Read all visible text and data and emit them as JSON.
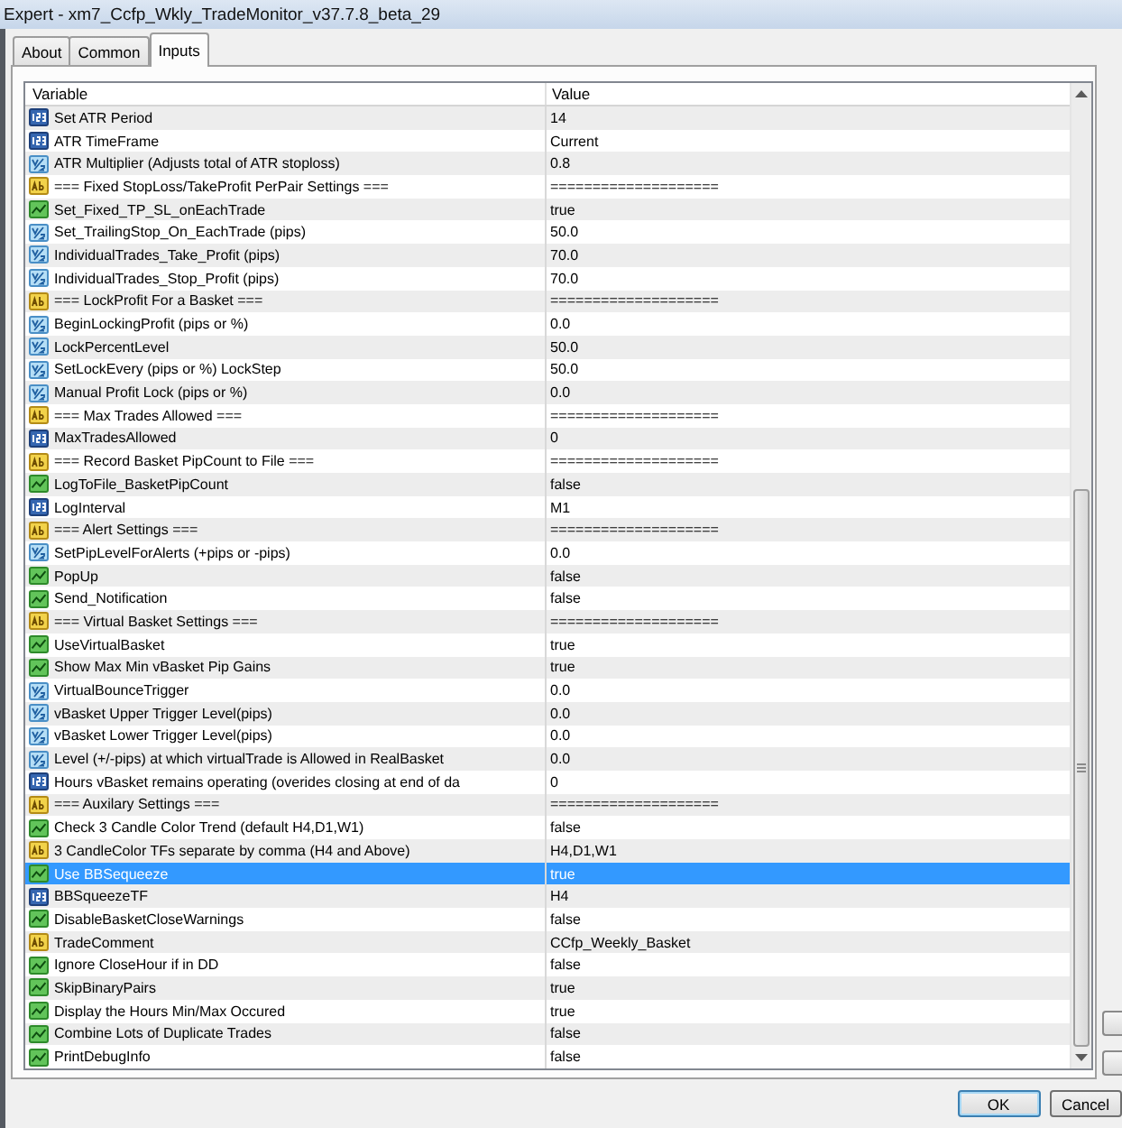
{
  "window": {
    "title": "Expert - xm7_Ccfp_Wkly_TradeMonitor_v37.7.8_beta_29"
  },
  "tabs": [
    {
      "label": "About",
      "selected": false
    },
    {
      "label": "Common",
      "selected": false
    },
    {
      "label": "Inputs",
      "selected": true
    }
  ],
  "inputs": {
    "columns": [
      "Variable",
      "Value"
    ],
    "rows": [
      {
        "kind": "int",
        "variable": "Set ATR Period",
        "value": "14",
        "selected": false
      },
      {
        "kind": "int",
        "variable": "ATR TimeFrame",
        "value": "Current",
        "selected": false
      },
      {
        "kind": "double",
        "variable": "ATR Multiplier (Adjusts total of ATR stoploss)",
        "value": "0.8",
        "selected": false
      },
      {
        "kind": "string",
        "variable": "=== Fixed StopLoss/TakeProfit PerPair Settings ===",
        "value": "====================",
        "selected": false
      },
      {
        "kind": "bool",
        "variable": "Set_Fixed_TP_SL_onEachTrade",
        "value": "true",
        "selected": false
      },
      {
        "kind": "double",
        "variable": "Set_TrailingStop_On_EachTrade (pips)",
        "value": "50.0",
        "selected": false
      },
      {
        "kind": "double",
        "variable": "IndividualTrades_Take_Profit (pips)",
        "value": "70.0",
        "selected": false
      },
      {
        "kind": "double",
        "variable": "IndividualTrades_Stop_Profit (pips)",
        "value": "70.0",
        "selected": false
      },
      {
        "kind": "string",
        "variable": "=== LockProfit For a Basket ===",
        "value": "====================",
        "selected": false
      },
      {
        "kind": "double",
        "variable": "BeginLockingProfit (pips or %)",
        "value": "0.0",
        "selected": false
      },
      {
        "kind": "double",
        "variable": "LockPercentLevel",
        "value": "50.0",
        "selected": false
      },
      {
        "kind": "double",
        "variable": "SetLockEvery (pips or %)  LockStep",
        "value": "50.0",
        "selected": false
      },
      {
        "kind": "double",
        "variable": "Manual Profit Lock (pips or %)",
        "value": "0.0",
        "selected": false
      },
      {
        "kind": "string",
        "variable": "=== Max Trades Allowed ===",
        "value": "====================",
        "selected": false
      },
      {
        "kind": "int",
        "variable": "MaxTradesAllowed",
        "value": "0",
        "selected": false
      },
      {
        "kind": "string",
        "variable": "=== Record Basket PipCount to File ===",
        "value": "====================",
        "selected": false
      },
      {
        "kind": "bool",
        "variable": "LogToFile_BasketPipCount",
        "value": "false",
        "selected": false
      },
      {
        "kind": "int",
        "variable": "LogInterval",
        "value": "M1",
        "selected": false
      },
      {
        "kind": "string",
        "variable": "=== Alert Settings ===",
        "value": "====================",
        "selected": false
      },
      {
        "kind": "double",
        "variable": "SetPipLevelForAlerts (+pips or -pips)",
        "value": "0.0",
        "selected": false
      },
      {
        "kind": "bool",
        "variable": "PopUp",
        "value": "false",
        "selected": false
      },
      {
        "kind": "bool",
        "variable": "Send_Notification",
        "value": "false",
        "selected": false
      },
      {
        "kind": "string",
        "variable": "=== Virtual Basket Settings ===",
        "value": "====================",
        "selected": false
      },
      {
        "kind": "bool",
        "variable": "UseVirtualBasket",
        "value": "true",
        "selected": false
      },
      {
        "kind": "bool",
        "variable": "Show Max Min vBasket Pip Gains",
        "value": "true",
        "selected": false
      },
      {
        "kind": "double",
        "variable": "VirtualBounceTrigger",
        "value": "0.0",
        "selected": false
      },
      {
        "kind": "double",
        "variable": "vBasket Upper Trigger Level(pips)",
        "value": "0.0",
        "selected": false
      },
      {
        "kind": "double",
        "variable": "vBasket Lower Trigger Level(pips)",
        "value": "0.0",
        "selected": false
      },
      {
        "kind": "double",
        "variable": "Level (+/-pips) at which virtualTrade is Allowed in RealBasket",
        "value": "0.0",
        "selected": false
      },
      {
        "kind": "int",
        "variable": "Hours vBasket remains operating (overides closing at end of da",
        "value": "0",
        "selected": false
      },
      {
        "kind": "string",
        "variable": "=== Auxilary Settings ===",
        "value": "====================",
        "selected": false
      },
      {
        "kind": "bool",
        "variable": "Check 3 Candle Color Trend (default H4,D1,W1)",
        "value": "false",
        "selected": false
      },
      {
        "kind": "string",
        "variable": "3 CandleColor TFs separate by comma (H4 and Above)",
        "value": "H4,D1,W1",
        "selected": false
      },
      {
        "kind": "bool",
        "variable": "Use BBSequeeze",
        "value": "true",
        "selected": true
      },
      {
        "kind": "int",
        "variable": "BBSqueezeTF",
        "value": "H4",
        "selected": false
      },
      {
        "kind": "bool",
        "variable": "DisableBasketCloseWarnings",
        "value": "false",
        "selected": false
      },
      {
        "kind": "string",
        "variable": "TradeComment",
        "value": "CCfp_Weekly_Basket",
        "selected": false
      },
      {
        "kind": "bool",
        "variable": "Ignore CloseHour if in DD",
        "value": "false",
        "selected": false
      },
      {
        "kind": "bool",
        "variable": "SkipBinaryPairs",
        "value": "true",
        "selected": false
      },
      {
        "kind": "bool",
        "variable": "Display the Hours Min/Max Occured",
        "value": "true",
        "selected": false
      },
      {
        "kind": "bool",
        "variable": "Combine Lots of Duplicate Trades",
        "value": "false",
        "selected": false
      },
      {
        "kind": "bool",
        "variable": "PrintDebugInfo",
        "value": "false",
        "selected": false
      }
    ]
  },
  "buttons": [
    {
      "label": "OK",
      "default": true
    },
    {
      "label": "Cancel",
      "default": false
    }
  ]
}
